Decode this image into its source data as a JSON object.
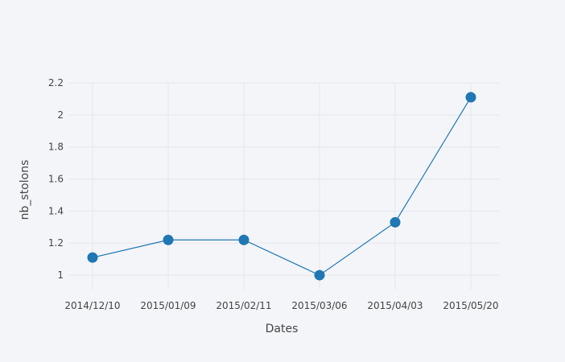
{
  "chart_data": {
    "type": "line",
    "title": "",
    "xlabel": "Dates",
    "ylabel": "nb_stolons",
    "x": [
      "2014/12/10",
      "2015/01/09",
      "2015/02/11",
      "2015/03/06",
      "2015/04/03",
      "2015/05/20"
    ],
    "series": [
      {
        "values": [
          1.11,
          1.22,
          1.22,
          1.0,
          1.33,
          2.11
        ]
      }
    ],
    "ylim": [
      0.91,
      2.2
    ],
    "yticks": [
      "1",
      "1.2",
      "1.4",
      "1.6",
      "1.8",
      "2",
      "2.2"
    ],
    "grid": true,
    "legend": false,
    "markers": true,
    "colors": {
      "series": "#1f77b4",
      "background": "#f4f5f9",
      "grid": "#e3e6ec",
      "text": "#444444"
    }
  }
}
